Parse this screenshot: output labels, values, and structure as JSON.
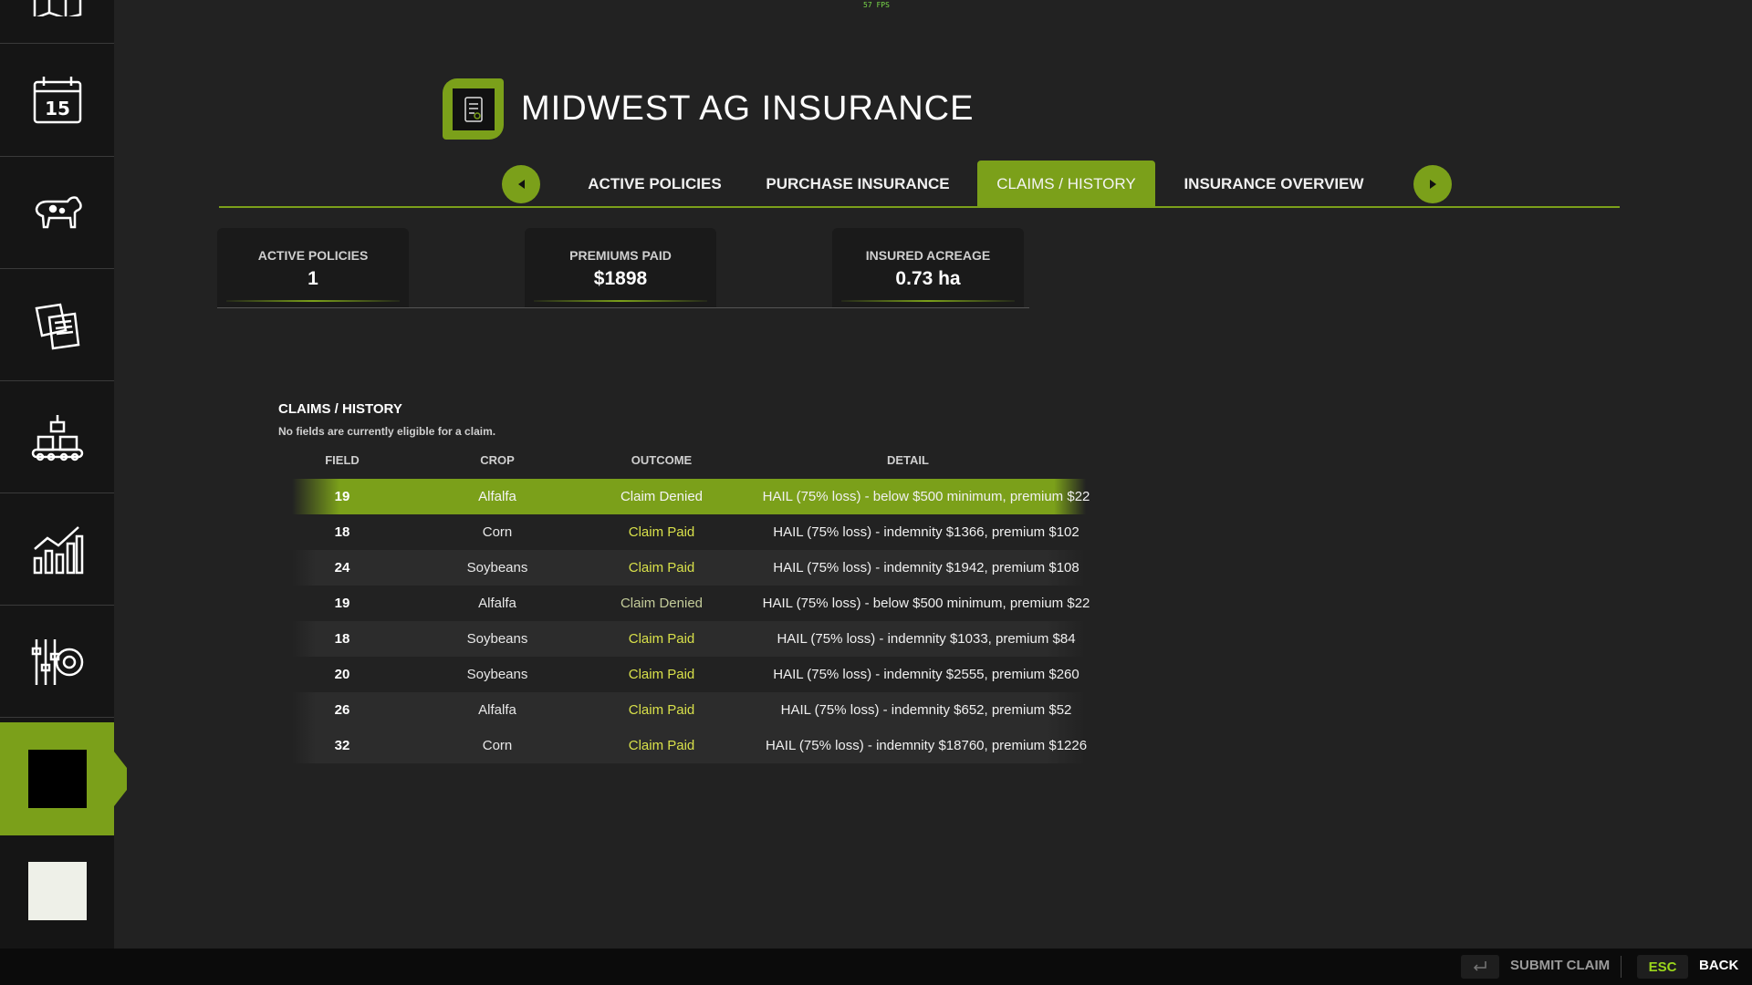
{
  "fps": "57 FPS",
  "header": {
    "title": "MIDWEST AG INSURANCE"
  },
  "tabs": [
    {
      "label": "ACTIVE POLICIES"
    },
    {
      "label": "PURCHASE INSURANCE"
    },
    {
      "label": "CLAIMS / HISTORY",
      "active": true
    },
    {
      "label": "INSURANCE OVERVIEW"
    }
  ],
  "stats": [
    {
      "label": "ACTIVE POLICIES",
      "value": "1"
    },
    {
      "label": "PREMIUMS PAID",
      "value": "$1898"
    },
    {
      "label": "INSURED ACREAGE",
      "value": "0.73 ha"
    }
  ],
  "claims": {
    "title": "CLAIMS / HISTORY",
    "subtitle": "No fields are currently eligible for a claim.",
    "columns": [
      "FIELD",
      "CROP",
      "OUTCOME",
      "DETAIL"
    ],
    "rows": [
      {
        "field": "19",
        "crop": "Alfalfa",
        "outcome": "Claim Denied",
        "detail": "HAIL (75% loss) - below $500 minimum, premium $22"
      },
      {
        "field": "18",
        "crop": "Corn",
        "outcome": "Claim Paid",
        "detail": "HAIL (75% loss) - indemnity $1366, premium $102"
      },
      {
        "field": "24",
        "crop": "Soybeans",
        "outcome": "Claim Paid",
        "detail": "HAIL (75% loss) - indemnity $1942, premium $108"
      },
      {
        "field": "19",
        "crop": "Alfalfa",
        "outcome": "Claim Denied",
        "detail": "HAIL (75% loss) - below $500 minimum, premium $22"
      },
      {
        "field": "18",
        "crop": "Soybeans",
        "outcome": "Claim Paid",
        "detail": "HAIL (75% loss) - indemnity $1033, premium $84"
      },
      {
        "field": "20",
        "crop": "Soybeans",
        "outcome": "Claim Paid",
        "detail": "HAIL (75% loss) - indemnity $2555, premium $260"
      },
      {
        "field": "26",
        "crop": "Alfalfa",
        "outcome": "Claim Paid",
        "detail": "HAIL (75% loss) - indemnity $652, premium $52"
      },
      {
        "field": "32",
        "crop": "Corn",
        "outcome": "Claim Paid",
        "detail": "HAIL (75% loss) - indemnity $18760, premium $1226"
      }
    ]
  },
  "sidebar": {
    "items": [
      {
        "icon": "map-icon"
      },
      {
        "icon": "calendar-icon",
        "text": "15"
      },
      {
        "icon": "livestock-icon"
      },
      {
        "icon": "contracts-icon"
      },
      {
        "icon": "production-icon"
      },
      {
        "icon": "statistics-icon"
      },
      {
        "icon": "settings-icon"
      },
      {
        "icon": "insurance-icon",
        "active": true
      },
      {
        "icon": "blank-icon"
      }
    ]
  },
  "footer": {
    "submit_label": "SUBMIT CLAIM",
    "esc_key": "ESC",
    "back_label": "BACK"
  },
  "colors": {
    "accent": "#7ba01a",
    "paid": "#d8e04a",
    "background": "#222222"
  }
}
